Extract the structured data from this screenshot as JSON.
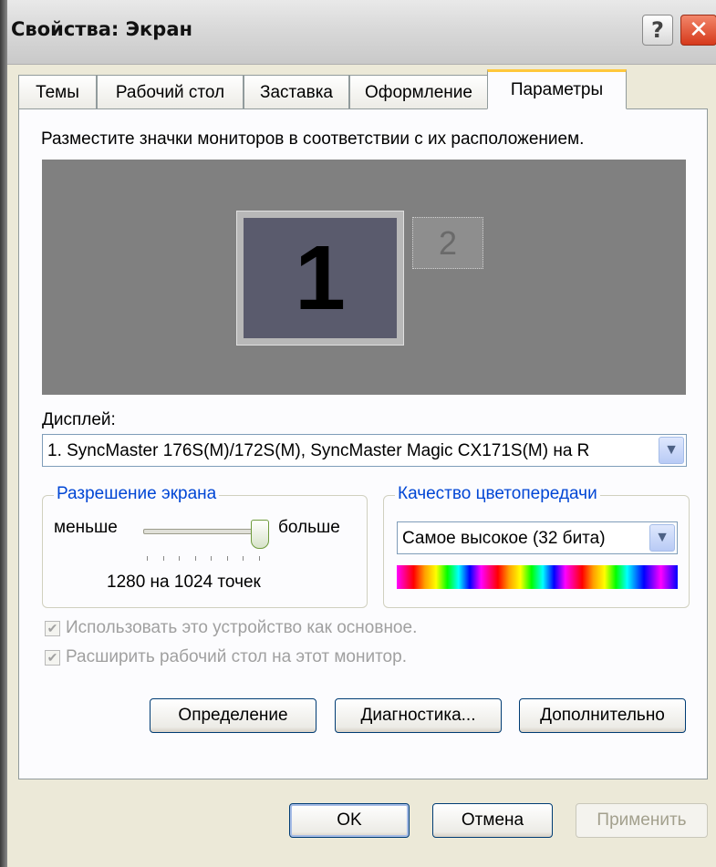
{
  "window": {
    "title": "Свойства: Экран"
  },
  "titlebar": {
    "help_label": "?",
    "close_label": "✕"
  },
  "tabs": [
    {
      "label": "Темы"
    },
    {
      "label": "Рабочий стол"
    },
    {
      "label": "Заставка"
    },
    {
      "label": "Оформление"
    },
    {
      "label": "Параметры",
      "active": true
    }
  ],
  "panel": {
    "instruction": "Разместите значки мониторов в соответствии с их расположением.",
    "monitors": [
      {
        "label": "1"
      },
      {
        "label": "2"
      }
    ],
    "display_label": "Дисплей:",
    "display_value": "1. SyncMaster 176S(M)/172S(M), SyncMaster Magic CX171S(M)  на R",
    "resolution": {
      "title": "Разрешение экрана",
      "less": "меньше",
      "more": "больше",
      "value_text": "1280 на 1024 точек",
      "slider_level": 1.0
    },
    "color_quality": {
      "title": "Качество цветопередачи",
      "value": "Самое высокое (32 бита)"
    },
    "checkbox_primary": "Использовать это устройство как основное.",
    "checkbox_extend": "Расширить рабочий стол на этот монитор.",
    "btn_identify": "Определение",
    "btn_troubleshoot": "Диагностика...",
    "btn_advanced": "Дополнительно"
  },
  "footer": {
    "ok": "OK",
    "cancel": "Отмена",
    "apply": "Применить"
  }
}
